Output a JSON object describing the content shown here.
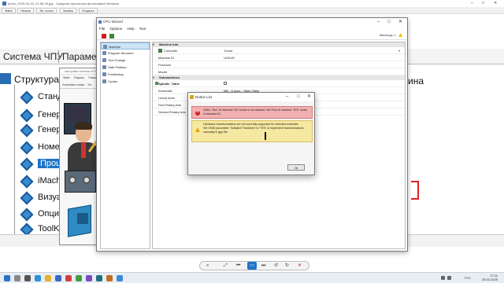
{
  "viewer": {
    "title": "photo_2025-02-25_21-56-28.jpg - Средство просмотра фотографий Windows",
    "menu": [
      "Файл",
      "Печать",
      "Эл. почта",
      "Запись",
      "Открыть"
    ]
  },
  "bg_app": {
    "tabs": [
      "Система ЧПУ",
      "Параметры"
    ],
    "structure_title": "Структура",
    "tree_items": [
      "Станд",
      "Генер",
      "Генер",
      "Номер",
      "Проце",
      "iMach",
      "Визуа",
      "Опци",
      "ToolK"
    ],
    "selected_index": 4,
    "right_text": "ина"
  },
  "win2": {
    "title": "Настройка системы ЧПУ",
    "menu": [
      "Файл",
      "Открыть",
      "Показ"
    ],
    "toolbar_label": "Установки станка",
    "toolbar_label2": "Уст"
  },
  "wizard": {
    "title": "CPU Wizard",
    "menu": [
      "File",
      "Options",
      "Help",
      "Tool"
    ],
    "warnings": "Warnings: 1",
    "nav": [
      "Machine",
      "Program Structure",
      "Tool Change",
      "Safe Position",
      "Positioning",
      "Cycles"
    ],
    "nav_selected": 0,
    "sections": {
      "machine_info": "Machine Info",
      "submachines": "Submachines"
    },
    "columns": {
      "key": "Controller",
      "value": "Turner"
    },
    "machine_rows": [
      {
        "k": "Machine ID",
        "v": "UHVUE"
      },
      {
        "k": "Producer",
        "v": ""
      },
      {
        "k": "Model",
        "v": ""
      }
    ],
    "spindle_table": "Spindle_Table",
    "sub_rows": [
      {
        "k": "Kinematic",
        "v": "Mill - 5 axes - Table-Table"
      },
      {
        "k": "Linear Axes",
        "v": ""
      },
      {
        "k": "First Rotary Axis",
        "v": ""
      },
      {
        "k": "Second Rotary Axis",
        "v": ""
      }
    ]
  },
  "dialog": {
    "title": "Notice List",
    "error_text": "VMID: 'Run To Machine' NO' mode is not allowed. Set 'Run to machine' YES' mode in Machine ID.",
    "warn_text_1": "Hardware transformations are not currently supported for selected controller.",
    "warn_text_2": "Set VMID parameter 'Software Transform' to 'YES' or implement transformations manually in gpp file.",
    "ok_label": "Ok"
  },
  "zoom_bar": {
    "icons": [
      "zoom-icon",
      "fit-icon",
      "prev-icon",
      "slideshow-icon",
      "next-icon",
      "rotate-left-icon",
      "rotate-right-icon",
      "delete-icon"
    ]
  },
  "taskbar": {
    "lang": "РУС",
    "time": "17:11",
    "date": "25.02.2025"
  }
}
